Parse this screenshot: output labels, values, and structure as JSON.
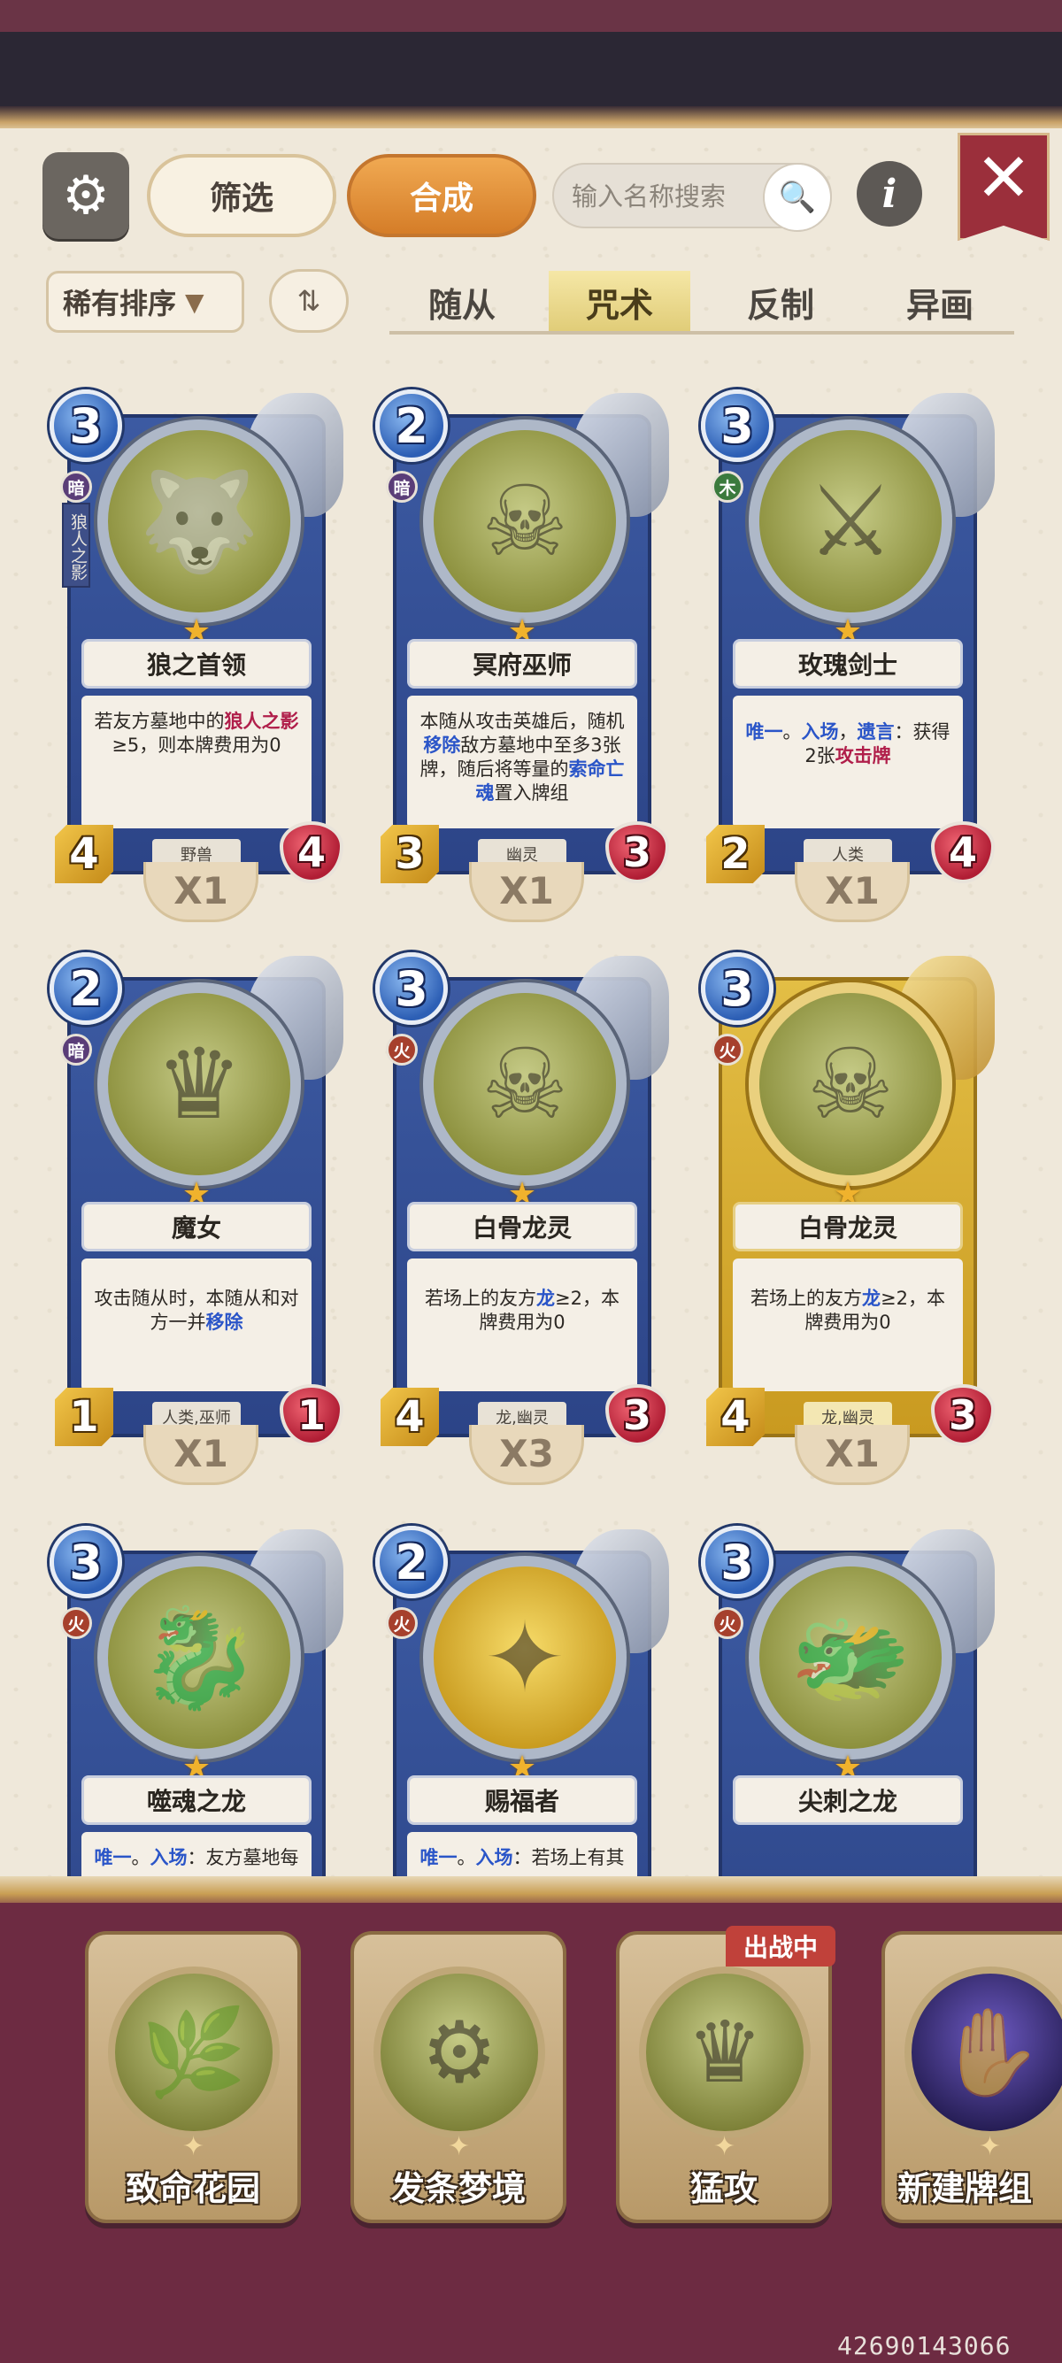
{
  "header": {
    "filter_label": "筛选",
    "compose_label": "合成",
    "search_placeholder": "输入名称搜索",
    "info_label": "i",
    "close_label": "✕",
    "sort_label": "稀有排序"
  },
  "tabs": [
    {
      "label": "随从",
      "active": false
    },
    {
      "label": "咒术",
      "active": true
    },
    {
      "label": "反制",
      "active": false
    },
    {
      "label": "异画",
      "active": false
    }
  ],
  "cards": [
    {
      "cost": "3",
      "faction": "暗",
      "bookmark": "狼人之影",
      "name": "狼之首领",
      "tribe": "野兽",
      "atk": "4",
      "hp": "4",
      "count": "X1",
      "art": "🐺",
      "golden": false
    },
    {
      "cost": "2",
      "faction": "暗",
      "name": "冥府巫师",
      "tribe": "幽灵",
      "atk": "3",
      "hp": "3",
      "count": "X1",
      "art": "☠",
      "golden": false
    },
    {
      "cost": "3",
      "faction": "木",
      "name": "玫瑰剑士",
      "tribe": "人类",
      "atk": "2",
      "hp": "4",
      "count": "X1",
      "art": "⚔",
      "golden": false
    },
    {
      "cost": "2",
      "faction": "暗",
      "name": "魔女",
      "tribe": "人类,巫师",
      "atk": "1",
      "hp": "1",
      "count": "X1",
      "art": "♛",
      "golden": false
    },
    {
      "cost": "3",
      "faction": "火",
      "name": "白骨龙灵",
      "tribe": "龙,幽灵",
      "atk": "4",
      "hp": "3",
      "count": "X3",
      "art": "☠",
      "golden": false
    },
    {
      "cost": "3",
      "faction": "火",
      "name": "白骨龙灵",
      "tribe": "龙,幽灵",
      "atk": "4",
      "hp": "3",
      "count": "X1",
      "art": "☠",
      "golden": true
    },
    {
      "cost": "3",
      "faction": "火",
      "name": "噬魂之龙",
      "art": "🐉",
      "golden": false
    },
    {
      "cost": "2",
      "faction": "火",
      "name": "赐福者",
      "art": "✦",
      "golden": false
    },
    {
      "cost": "3",
      "faction": "火",
      "name": "尖刺之龙",
      "art": "🐲",
      "golden": false
    }
  ],
  "card_texts": {
    "c0": [
      "若友方墓地中的",
      "狼人之影",
      "≥5，则本牌费用为0"
    ],
    "c1": [
      "本随从攻击英雄后，随机",
      "移除",
      "敌方墓地中至多3张牌，随后将等量的",
      "索命亡魂",
      "置入牌组"
    ],
    "c2": [
      "唯一",
      "。",
      "入场",
      "，",
      "遗言",
      "：获得2张",
      "攻击牌"
    ],
    "c3": [
      "攻击随从时，本随从和对方一并",
      "移除"
    ],
    "c4": [
      "若场上的友方",
      "龙",
      "≥2，本牌费用为0"
    ],
    "c5": [
      "若场上的友方",
      "龙",
      "≥2，本牌费用为0"
    ],
    "c6": [
      "唯一",
      "。",
      "入场",
      "：友方墓地每"
    ],
    "c7": [
      "唯一",
      "。",
      "入场",
      "：若场上有其"
    ]
  },
  "decks": [
    {
      "name": "致命花园",
      "art": "🌿",
      "active": false
    },
    {
      "name": "发条梦境",
      "art": "⚙",
      "active": false
    },
    {
      "name": "猛攻",
      "art": "♛",
      "active": true
    },
    {
      "name": "新建牌组",
      "art": "✋",
      "active": false
    }
  ],
  "active_tag": "出战中",
  "watermark": "42690143066",
  "colors": {
    "accent_orange": "#e08f34",
    "close_red": "#9b2f3b",
    "card_blue": "#2c4487",
    "card_gold": "#d9b036",
    "highlight_red": "#b01e4a",
    "highlight_blue": "#2a55c8",
    "bottom_bg": "#6d2b42"
  }
}
